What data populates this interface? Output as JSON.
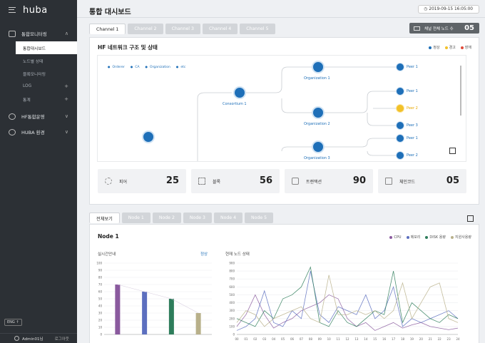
{
  "app": {
    "logo": "huba"
  },
  "sidebar": {
    "groups": [
      {
        "label": "통합모니터링",
        "icon": "monitor-icon",
        "chevron": "∧"
      },
      {
        "label": "HF통합운영",
        "icon": "shield-icon",
        "chevron": "∨"
      },
      {
        "label": "HUBA 환경",
        "icon": "gear-icon",
        "chevron": "∨"
      }
    ],
    "subitems": [
      {
        "label": "통합대시보드",
        "active": true
      },
      {
        "label": "노드별 상태"
      },
      {
        "label": "블록모니터링"
      },
      {
        "label": "LOG",
        "plus": "+"
      },
      {
        "label": "통계",
        "plus": "+"
      }
    ],
    "lang": "ENG",
    "user": "Admin01님",
    "logout": "로그아웃"
  },
  "header": {
    "title": "통합 대시보드",
    "datetime": "2019-09-15 16:05:00"
  },
  "channel_tabs": [
    "Channel 1",
    "Channel 2",
    "Channel 3",
    "Channel 4",
    "Channel 5"
  ],
  "node_count": {
    "label": "채널 전체 노드 수",
    "value": "05"
  },
  "network": {
    "title": "HF 네트워크 구조 및 상태",
    "legend": [
      {
        "label": "정상",
        "color": "#1e6fb8"
      },
      {
        "label": "경고",
        "color": "#f2c128"
      },
      {
        "label": "장애",
        "color": "#e04b3a"
      }
    ],
    "types": [
      "Orderer",
      "CA",
      "Organization",
      "etc"
    ],
    "consortium": "Consortium 1",
    "org1": "Organization 1",
    "org2": "Organization 2",
    "org3": "Organization 3",
    "peers": [
      "Peer 1",
      "Peer 1",
      "Peer 2",
      "Peer 3",
      "Peer 1",
      "Peer 2"
    ]
  },
  "stats": [
    {
      "label": "피어",
      "value": "25",
      "icon": "peer-icon"
    },
    {
      "label": "블록",
      "value": "56",
      "icon": "block-icon"
    },
    {
      "label": "트랜잭션",
      "value": "90",
      "icon": "transaction-icon"
    },
    {
      "label": "체인코드",
      "value": "05",
      "icon": "chaincode-icon"
    }
  ],
  "node_tabs": [
    "전체보기",
    "Node 1",
    "Node 2",
    "Node 3",
    "Node 4",
    "Node 5"
  ],
  "node_panel": {
    "title": "Node 1",
    "legend": [
      {
        "label": "CPU",
        "color": "#8a5a9e"
      },
      {
        "label": "메모리",
        "color": "#5c6fbf"
      },
      {
        "label": "DISK 용량",
        "color": "#2e7d5b"
      },
      {
        "label": "지원사용량",
        "color": "#b8b08a"
      }
    ],
    "realtime_label": "실시간안내",
    "status_text": "정상",
    "current_label": "현재 노드 상태"
  },
  "chart_data": [
    {
      "type": "bar",
      "categories": [
        "CPU",
        "메모리",
        "DISK 용량",
        "지원사용량"
      ],
      "values": [
        70,
        60,
        50,
        30
      ],
      "ylim": [
        0,
        100
      ],
      "yticks": [
        0,
        10,
        20,
        30,
        40,
        50,
        60,
        70,
        80,
        90,
        100
      ],
      "colors": [
        "#8a5a9e",
        "#5c6fbf",
        "#2e7d5b",
        "#b8b08a"
      ]
    },
    {
      "type": "line",
      "x": [
        "00",
        "01",
        "02",
        "03",
        "04",
        "05",
        "06",
        "07",
        "08",
        "09",
        "10",
        "11",
        "12",
        "13",
        "14",
        "15",
        "16",
        "17",
        "18",
        "19",
        "20",
        "21",
        "22",
        "23",
        "24"
      ],
      "ylim": [
        0,
        900
      ],
      "yticks": [
        0,
        100,
        200,
        300,
        400,
        500,
        600,
        700,
        800,
        900
      ],
      "series": [
        {
          "name": "CPU",
          "color": "#8a5a9e",
          "values": [
            100,
            250,
            500,
            250,
            80,
            150,
            200,
            300,
            350,
            400,
            500,
            450,
            200,
            100,
            150,
            50,
            100,
            150,
            80,
            120,
            150,
            100,
            80,
            60,
            80
          ]
        },
        {
          "name": "메모리",
          "color": "#5c6fbf",
          "values": [
            50,
            100,
            200,
            550,
            150,
            100,
            300,
            200,
            800,
            250,
            150,
            350,
            300,
            250,
            500,
            200,
            300,
            600,
            100,
            200,
            150,
            200,
            250,
            300,
            200
          ]
        },
        {
          "name": "DISK 용량",
          "color": "#2e7d5b",
          "values": [
            200,
            150,
            100,
            300,
            200,
            450,
            500,
            600,
            850,
            150,
            100,
            300,
            150,
            100,
            200,
            300,
            250,
            800,
            150,
            400,
            300,
            200,
            150,
            250,
            200
          ]
        },
        {
          "name": "지원사용량",
          "color": "#b8b08a",
          "values": [
            150,
            300,
            250,
            100,
            200,
            250,
            300,
            350,
            200,
            150,
            750,
            250,
            250,
            300,
            250,
            300,
            200,
            300,
            650,
            200,
            400,
            600,
            650,
            200,
            150
          ]
        }
      ]
    }
  ]
}
